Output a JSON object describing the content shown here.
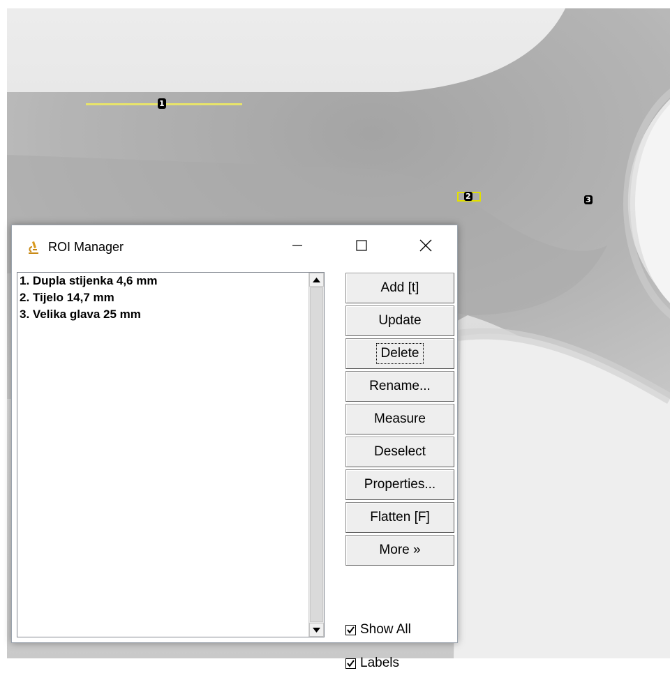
{
  "window": {
    "title": "ROI Manager",
    "minimize_glyph": "—",
    "maximize_glyph": "☐",
    "close_glyph": "✕",
    "app_icon": "microscope-icon"
  },
  "roi_list": {
    "items": [
      {
        "label": "1. Dupla stijenka 4,6 mm"
      },
      {
        "label": "2. Tijelo 14,7 mm"
      },
      {
        "label": "3. Velika glava 25 mm"
      }
    ]
  },
  "buttons": {
    "add": "Add [t]",
    "update": "Update",
    "delete": "Delete",
    "rename": "Rename...",
    "measure": "Measure",
    "deselect": "Deselect",
    "properties": "Properties...",
    "flatten": "Flatten [F]",
    "more": "More »"
  },
  "checkboxes": {
    "show_all": {
      "label": "Show All",
      "checked": true
    },
    "labels": {
      "label": "Labels",
      "checked": true
    }
  },
  "image_overlay": {
    "roi_labels": [
      "1",
      "2",
      "3"
    ],
    "roi_color": "#e8e46a"
  }
}
